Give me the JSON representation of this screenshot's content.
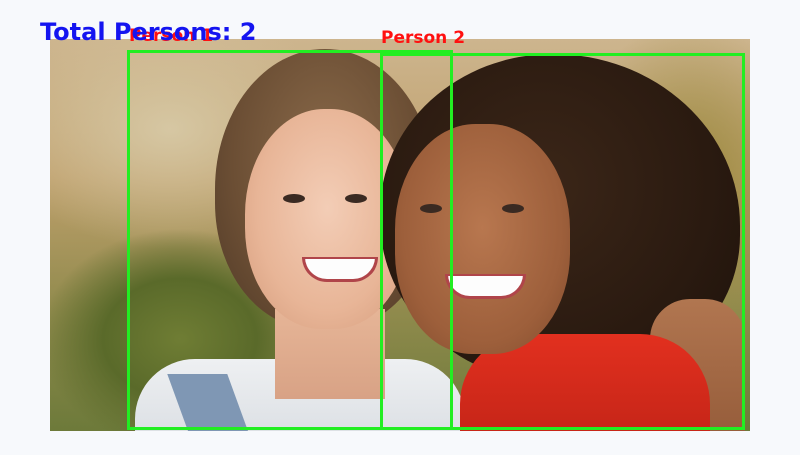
{
  "overlay": {
    "total_label": "Total Persons: 2",
    "label_color": "#ff1010",
    "total_color": "#1414f0",
    "box_color": "#22ee22"
  },
  "detections": [
    {
      "label": "Person 1"
    },
    {
      "label": "Person 2"
    }
  ]
}
